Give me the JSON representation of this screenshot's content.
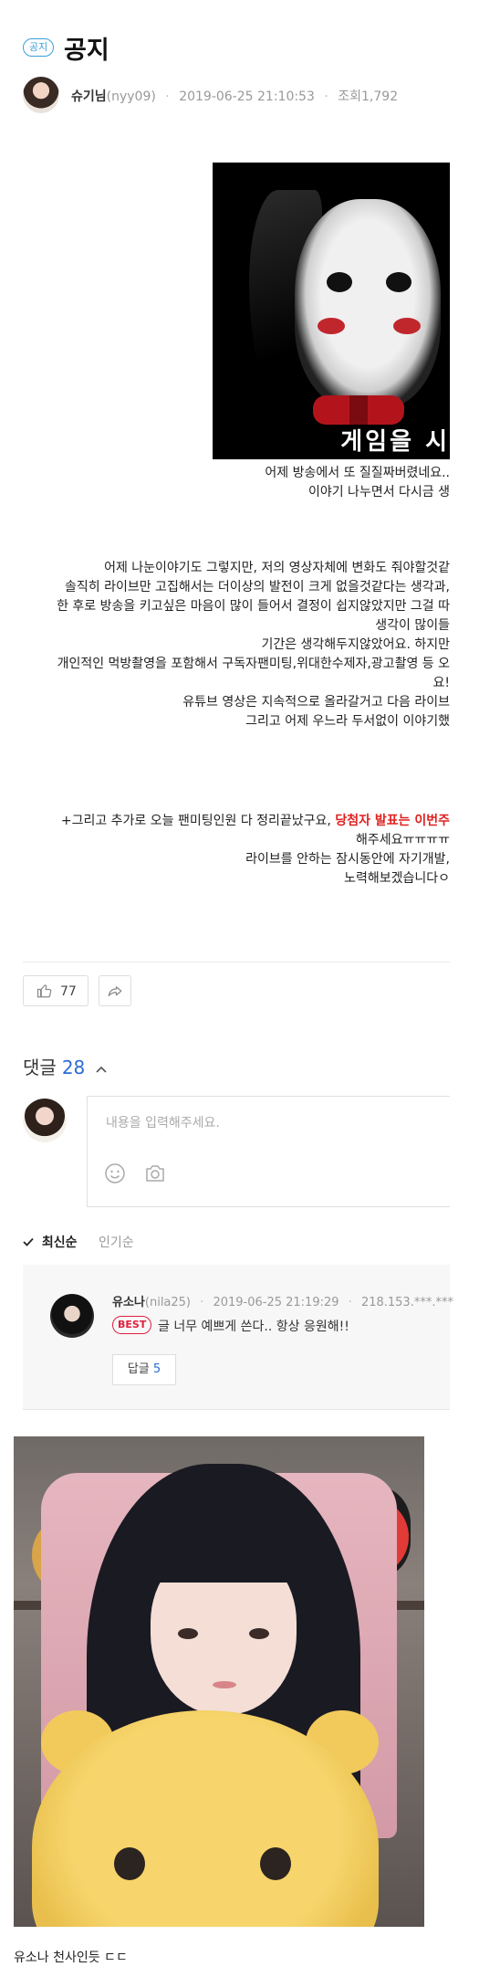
{
  "header": {
    "badge": "공지",
    "title": "공지",
    "author_nick": "슈기님",
    "author_id": "(nyy09)",
    "datetime": "2019-06-25 21:10:53",
    "views_label": "조회",
    "views": "1,792"
  },
  "article": {
    "image_caption": "게임을 시",
    "lines_group1": [
      "어제 방송에서 또 질질짜버렸네요..",
      "이야기 나누면서 다시금 생"
    ],
    "lines_group2": [
      "어제 나눈이야기도 그렇지만, 저의 영상자체에 변화도 줘야할것같",
      "솔직히 라이브만 고집해서는 더이상의 발전이 크게 없을것같다는 생각과,",
      "한 후로 방송을 키고싶은 마음이 많이 들어서 결정이 쉽지않았지만 그걸 따",
      "생각이 많이들",
      "기간은 생각해두지않았어요. 하지만",
      "개인적인 먹방촬영을 포함해서 구독자팬미팅,위대한수제자,광고촬영 등 오",
      "요!",
      "유튜브 영상은 지속적으로 올라갈거고 다음 라이브",
      "그리고 어제 우느라 두서없이 이야기했"
    ],
    "line_group3_prefix": "+그리고 추가로 오늘 팬미팅인원 다 정리끝났구요, ",
    "line_group3_red": "당첨자 발표는 이번주 ",
    "lines_group3": [
      "해주세요ㅠㅠㅠㅠ",
      "라이브를 안하는 잠시동안에 자기개발,",
      "노력해보겠습니다ㅇ"
    ]
  },
  "actions": {
    "like_icon": "thumbs-up-icon",
    "like_count": "77",
    "share_icon": "share-icon"
  },
  "comments": {
    "label": "댓글",
    "count": "28",
    "toggle_icon": "chevron-up-icon",
    "placeholder": "내용을 입력해주세요.",
    "emoji_icon": "emoji-icon",
    "camera_icon": "camera-icon",
    "sort_latest": "최신순",
    "sort_popular": "인기순",
    "best": {
      "nick": "유소나",
      "id": "(nila25)",
      "datetime": "2019-06-25 21:19:29",
      "ip": "218.153.***.***",
      "badge": "BEST",
      "text": "글 너무 예쁘게 쓴다.. 항상 응원해!!",
      "reply_label": "답글",
      "reply_count": "5"
    }
  },
  "feed": {
    "caption": "유소나 천사인듯 ㄷㄷ"
  }
}
